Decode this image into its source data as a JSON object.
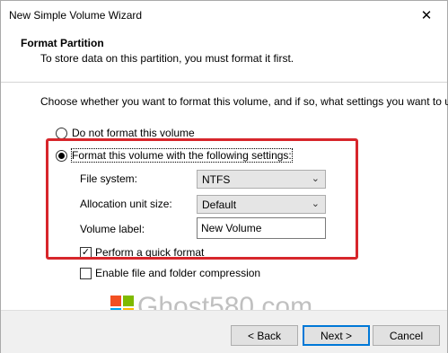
{
  "window": {
    "title": "New Simple Volume Wizard",
    "close_symbol": "✕"
  },
  "header": {
    "title": "Format Partition",
    "subtitle": "To store data on this partition, you must format it first."
  },
  "content": {
    "instruction": "Choose whether you want to format this volume, and if so, what settings you want to use.",
    "option_no_format": "Do not format this volume",
    "option_format": "Format this volume with the following settings:",
    "selected_option": "format",
    "file_system_label": "File system:",
    "file_system_value": "NTFS",
    "allocation_label": "Allocation unit size:",
    "allocation_value": "Default",
    "volume_label_label": "Volume label:",
    "volume_label_value": "New Volume",
    "quick_format_label": "Perform a quick format",
    "quick_format_checked": true,
    "compression_label": "Enable file and folder compression",
    "compression_checked": false,
    "highlight_color": "#d7262b"
  },
  "watermark": {
    "text": "Ghost580.com"
  },
  "footer": {
    "back_label": "< Back",
    "next_label": "Next >",
    "cancel_label": "Cancel"
  }
}
